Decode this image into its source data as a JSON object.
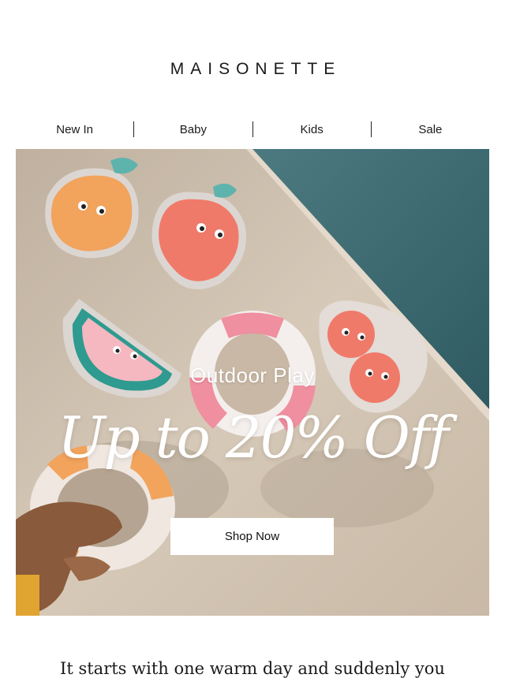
{
  "header": {
    "logo": "MAISONETTE"
  },
  "nav": {
    "items": [
      {
        "label": "New In"
      },
      {
        "label": "Baby"
      },
      {
        "label": "Kids"
      },
      {
        "label": "Sale"
      }
    ]
  },
  "hero": {
    "subtitle": "Outdoor Play",
    "title": "Up to 20% Off",
    "cta_label": "Shop Now"
  },
  "body": {
    "intro": "It starts with one warm day and suddenly you"
  },
  "colors": {
    "stone": "#cdbfae",
    "pool": "#3f6b72",
    "coral": "#f07a6a",
    "orange": "#f2a35c"
  }
}
